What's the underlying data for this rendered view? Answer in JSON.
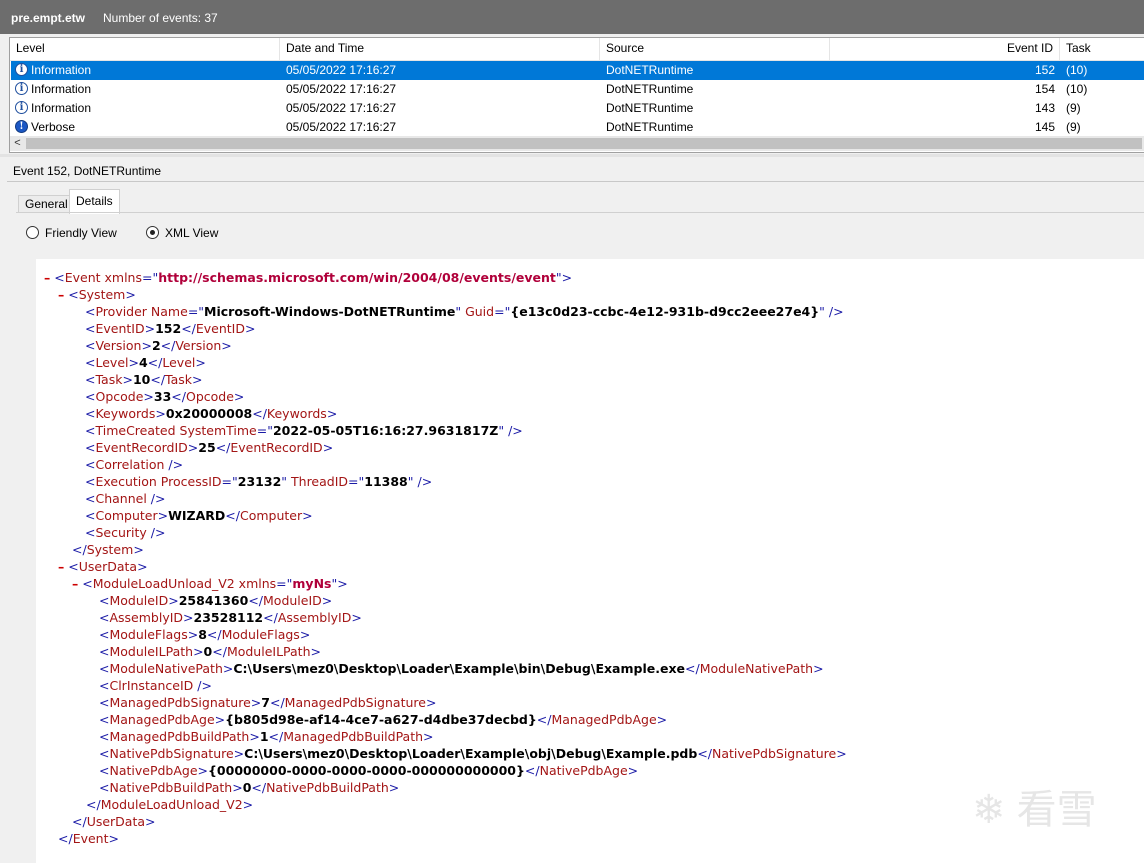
{
  "title": {
    "file": "pre.empt.etw",
    "count": "Number of events: 37"
  },
  "grid": {
    "headers": [
      "Level",
      "Date and Time",
      "Source",
      "Event ID",
      "Task Category"
    ],
    "rows": [
      {
        "icon": "information-icon",
        "level": "Information",
        "date": "05/05/2022 17:16:27",
        "source": "DotNETRuntime",
        "id": "152",
        "task": "(10)"
      },
      {
        "icon": "information-icon",
        "level": "Information",
        "date": "05/05/2022 17:16:27",
        "source": "DotNETRuntime",
        "id": "154",
        "task": "(10)"
      },
      {
        "icon": "information-icon",
        "level": "Information",
        "date": "05/05/2022 17:16:27",
        "source": "DotNETRuntime",
        "id": "143",
        "task": "(9)"
      },
      {
        "icon": "verbose-icon",
        "level": "Verbose",
        "date": "05/05/2022 17:16:27",
        "source": "DotNETRuntime",
        "id": "145",
        "task": "(9)"
      }
    ],
    "scroll_left": "<"
  },
  "detail": {
    "title": "Event 152, DotNETRuntime",
    "tabs": [
      "General",
      "Details"
    ],
    "radios": [
      "Friendly View",
      "XML View"
    ],
    "selected_view": "XML View"
  },
  "xml": {
    "minus": "–",
    "lt": "<",
    "gt": ">",
    "close": "</",
    "selfclose": " />",
    "eq": "=\"",
    "q": "\"",
    "event_tag": "Event",
    "xmlns_attr": " xmlns",
    "event_ns": "http://schemas.microsoft.com/win/2004/08/events/event",
    "system": "System",
    "provider": "Provider",
    "name_attr": " Name",
    "provider_name": "Microsoft-Windows-DotNETRuntime",
    "guid_attr": " Guid",
    "guid": "{e13c0d23-ccbc-4e12-931b-d9cc2eee27e4}",
    "eventid_tag": "EventID",
    "eventid": "152",
    "version_tag": "Version",
    "version": "2",
    "level_tag": "Level",
    "level": "4",
    "task_tag": "Task",
    "task": "10",
    "opcode_tag": "Opcode",
    "opcode": "33",
    "keywords_tag": "Keywords",
    "keywords": "0x20000008",
    "timecreated_tag": "TimeCreated",
    "systemtime_attr": " SystemTime",
    "systemtime": "2022-05-05T16:16:27.9631817Z",
    "recordid_tag": "EventRecordID",
    "recordid": "25",
    "correlation_tag": "Correlation",
    "execution_tag": "Execution",
    "pid_attr": " ProcessID",
    "pid": "23132",
    "tid_attr": " ThreadID",
    "tid": "11388",
    "channel_tag": "Channel",
    "computer_tag": "Computer",
    "computer": "WIZARD",
    "security_tag": "Security",
    "userdata": "UserData",
    "module_tag": "ModuleLoadUnload_V2",
    "module_ns": "myNs",
    "moduleid_tag": "ModuleID",
    "moduleid": "25841360",
    "assemblyid_tag": "AssemblyID",
    "assemblyid": "23528112",
    "moduleflags_tag": "ModuleFlags",
    "moduleflags": "8",
    "moduleilpath_tag": "ModuleILPath",
    "moduleilpath": "0",
    "modulenativepath_tag": "ModuleNativePath",
    "modulenativepath": "C:\\Users\\mez0\\Desktop\\Loader\\Example\\bin\\Debug\\Example.exe",
    "clrinstanceid_tag": "ClrInstanceID",
    "mpdbsig_tag": "ManagedPdbSignature",
    "mpdbsig": "7",
    "mpdbage_tag": "ManagedPdbAge",
    "mpdbage": "{b805d98e-af14-4ce7-a627-d4dbe37decbd}",
    "mpdbbuild_tag": "ManagedPdbBuildPath",
    "mpdbbuild": "1",
    "npdbsig_tag": "NativePdbSignature",
    "npdbsig": "C:\\Users\\mez0\\Desktop\\Loader\\Example\\obj\\Debug\\Example.pdb",
    "npdbage_tag": "NativePdbAge",
    "npdbage": "{00000000-0000-0000-0000-000000000000}",
    "npdbbuild_tag": "NativePdbBuildPath",
    "npdbbuild": "0"
  },
  "watermark": "❄ 看雪"
}
